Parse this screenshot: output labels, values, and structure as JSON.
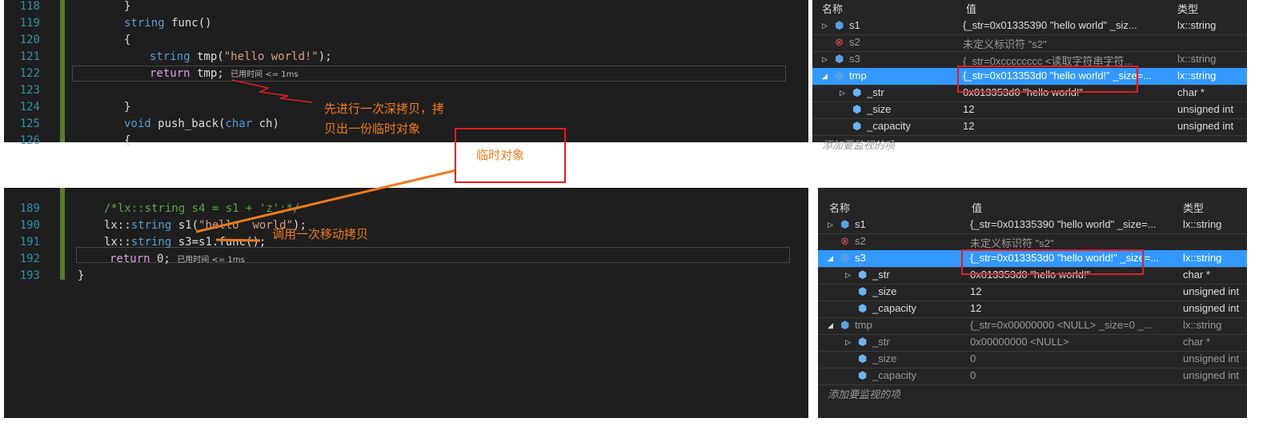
{
  "top_editor": {
    "lines": [
      {
        "n": "118",
        "code": "}"
      },
      {
        "n": "119",
        "code": "string func()"
      },
      {
        "n": "120",
        "code": "{"
      },
      {
        "n": "121",
        "code": "string tmp(\"hello world!\");"
      },
      {
        "n": "122",
        "code": "return tmp;",
        "perf": "已用时间 <= 1ms"
      },
      {
        "n": "123",
        "code": ""
      },
      {
        "n": "124",
        "code": "}"
      },
      {
        "n": "125",
        "code": "void push_back(char ch)"
      },
      {
        "n": "126",
        "code": "{"
      }
    ]
  },
  "bottom_editor": {
    "lines": [
      {
        "n": "189",
        "code": "/*lx::string s4 = s1 + 'z';*/"
      },
      {
        "n": "190",
        "code": "lx::string s1(\"hello  world\");"
      },
      {
        "n": "191",
        "code": "lx::string s3=s1.func();"
      },
      {
        "n": "192",
        "code": "return 0;",
        "perf": "已用时间 <= 1ms"
      },
      {
        "n": "193",
        "code": "}"
      }
    ]
  },
  "watch_headers": {
    "name": "名称",
    "value": "值",
    "type": "类型"
  },
  "top_watch": {
    "rows": [
      {
        "name": "s1",
        "value": "{_str=0x01335390 \"hello  world\" _siz...",
        "type": "lx::string",
        "icon": "object-icon"
      },
      {
        "name": "s2",
        "value": "未定义标识符 \"s2\"",
        "type": "",
        "icon": "error-icon"
      },
      {
        "name": "s3",
        "value": "{_str=0xcccccccc <读取字符串字符...",
        "type": "lx::string",
        "icon": "object-icon"
      },
      {
        "name": "tmp",
        "value": "{_str=0x013353d0 \"hello world!\" _size=...",
        "type": "lx::string",
        "icon": "object-icon",
        "selected": true
      },
      {
        "name": "_str",
        "value": "0x013353d0 \"hello world!\"",
        "type": "char *",
        "icon": "field-icon"
      },
      {
        "name": "_size",
        "value": "12",
        "type": "unsigned int",
        "icon": "field-icon"
      },
      {
        "name": "_capacity",
        "value": "12",
        "type": "unsigned int",
        "icon": "field-icon"
      }
    ],
    "add": "添加要监视的项"
  },
  "bottom_watch": {
    "rows": [
      {
        "name": "s1",
        "value": "{_str=0x01335390 \"hello  world\" _size=...",
        "type": "lx::string"
      },
      {
        "name": "s2",
        "value": "未定义标识符 \"s2\"",
        "type": ""
      },
      {
        "name": "s3",
        "value": "{_str=0x013353d0 \"hello world!\" _size=...",
        "type": "lx::string",
        "selected": true
      },
      {
        "name": "_str",
        "value": "0x013353d0 \"hello world!\"",
        "type": "char *"
      },
      {
        "name": "_size",
        "value": "12",
        "type": "unsigned int"
      },
      {
        "name": "_capacity",
        "value": "12",
        "type": "unsigned int"
      },
      {
        "name": "tmp",
        "value": "{_str=0x00000000 <NULL> _size=0 _...",
        "type": "lx::string"
      },
      {
        "name": "_str",
        "value": "0x00000000 <NULL>",
        "type": "char *"
      },
      {
        "name": "_size",
        "value": "0",
        "type": "unsigned int"
      },
      {
        "name": "_capacity",
        "value": "0",
        "type": "unsigned int"
      }
    ],
    "add": "添加要监视的项"
  },
  "annotations": {
    "deep_copy": "先进行一次深拷贝，拷",
    "deep_copy2": "贝出一份临时对象",
    "temp_object": "临时对象",
    "move_copy": "调用一次移动拷贝"
  },
  "colors": {
    "annotation": "#f07a1a",
    "highlight_box": "#e51c23",
    "selection": "#3399ff"
  }
}
